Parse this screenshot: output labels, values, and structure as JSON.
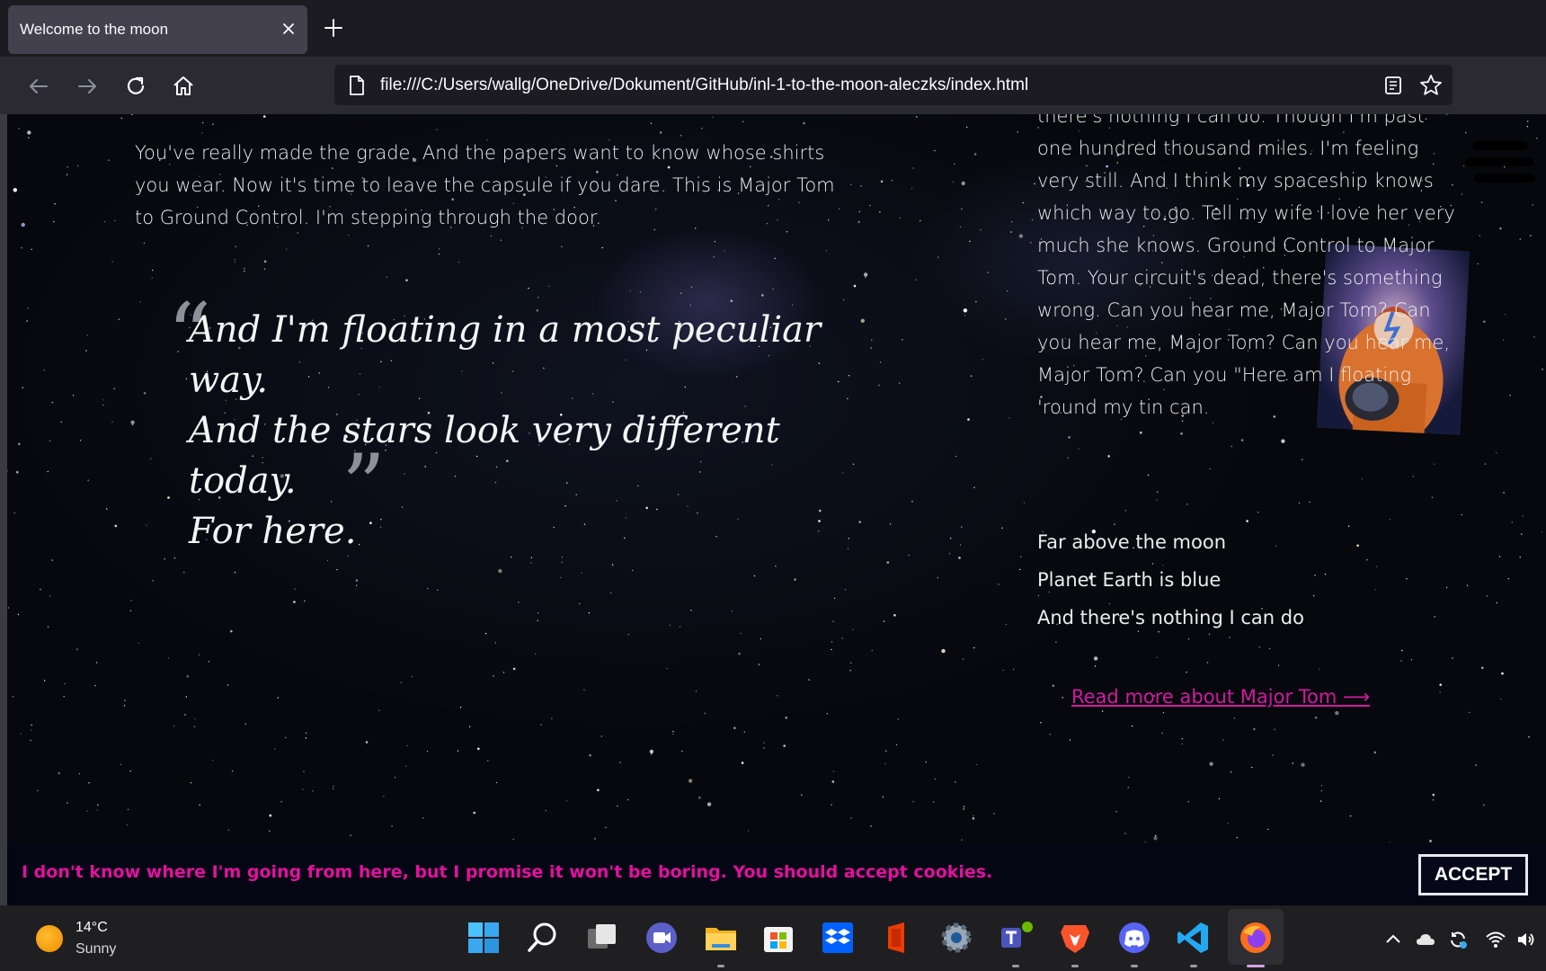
{
  "browser": {
    "tab_title": "Welcome to the moon",
    "url": "file:///C:/Users/wallg/OneDrive/Dokument/GitHub/inl-1-to-the-moon-aleczks/index.html"
  },
  "page": {
    "intro_paragraph": "You've really made the grade. And the papers want to know whose shirts you wear. Now it's time to leave the capsule if you dare. This is Major Tom to Ground Control. I'm stepping through the door.",
    "quote": {
      "open_mark": "“",
      "close_mark": "”",
      "line1": "And I'm floating in a most peculiar way.",
      "line2": "And the stars look very different today.",
      "line3": "For here."
    },
    "lyrics_paragraph": "there's nothing I can do. Though I'm past one hundred thousand miles. I'm feeling very still. And I think my spaceship knows which way to go. Tell my wife I love her very much she knows. Ground Control to Major Tom. Your circuit's dead, there's something wrong. Can you hear me, Major Tom? Can you hear me, Major Tom? Can you hear me, Major Tom? Can you \"Here am I floating 'round my tin can.",
    "lines": [
      "Far above the moon",
      "Planet Earth is blue",
      "And there's nothing I can do"
    ],
    "read_more": "Read more about Major Tom ⟶",
    "cookie_banner": {
      "text": "I don't know where I'm going from here, but I promise it won't be boring. You should accept cookies.",
      "accept_label": "ACCEPT"
    }
  },
  "taskbar": {
    "weather_temp": "14°C",
    "weather_condition": "Sunny",
    "apps": [
      "start",
      "search",
      "task-view",
      "chat",
      "file-explorer",
      "store",
      "dropbox",
      "office",
      "settings",
      "teams",
      "brave",
      "discord",
      "vscode",
      "firefox"
    ]
  },
  "colors": {
    "accent_pink": "#d21aa2",
    "cookie_text": "#e3109e",
    "browser_tab": "#42414d",
    "browser_toolbar": "#2b2a33"
  }
}
